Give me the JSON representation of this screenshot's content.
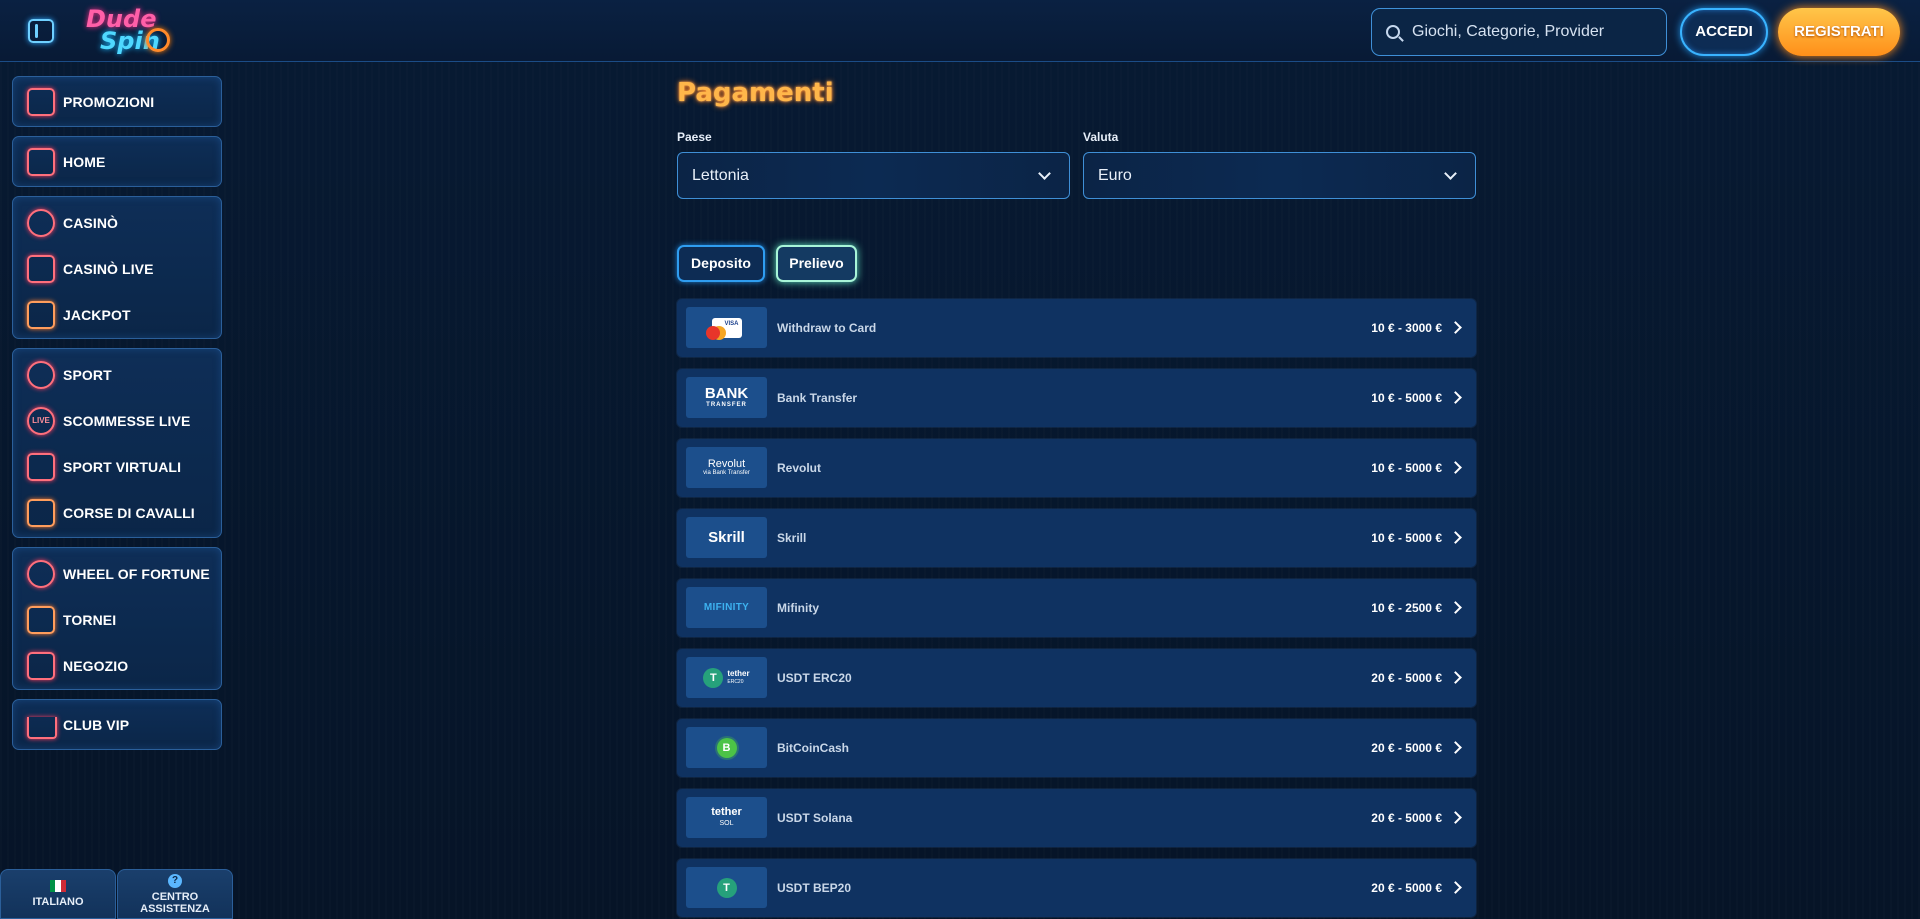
{
  "header": {
    "logo_line1": "Dude",
    "logo_line2": "Spin",
    "search_placeholder": "Giochi, Categorie, Provider",
    "login_label": "ACCEDI",
    "register_label": "REGISTRATI"
  },
  "sidebar": {
    "promotions": "PROMOZIONI",
    "home": "HOME",
    "casino": "CASINÒ",
    "casino_live": "CASINÒ LIVE",
    "jackpot": "JACKPOT",
    "sport": "SPORT",
    "live_bets": "SCOMMESSE LIVE",
    "virtual_sports": "SPORT VIRTUALI",
    "horse_racing": "CORSE DI CAVALLI",
    "wheel_of_fortune": "WHEEL OF FORTUNE",
    "tournaments": "TORNEI",
    "shop": "NEGOZIO",
    "vip_club": "CLUB VIP",
    "live_icon_text": "LIVE"
  },
  "footer": {
    "language": "ITALIANO",
    "help_line1": "CENTRO",
    "help_line2": "ASSISTENZA",
    "help_icon": "?"
  },
  "main": {
    "title": "Pagamenti",
    "country_label": "Paese",
    "country_value": "Lettonia",
    "currency_label": "Valuta",
    "currency_value": "Euro",
    "tab_deposit": "Deposito",
    "tab_withdraw": "Prelievo",
    "active_tab": "Prelievo",
    "methods": [
      {
        "name": "Withdraw to Card",
        "range": "10 € - 3000 €",
        "logo": "VISA"
      },
      {
        "name": "Bank Transfer",
        "range": "10 € - 5000 €",
        "logo": "BANK",
        "logo_sub": "TRANSFER"
      },
      {
        "name": "Revolut",
        "range": "10 € - 5000 €",
        "logo": "Revolut",
        "logo_sub": "via Bank Transfer"
      },
      {
        "name": "Skrill",
        "range": "10 € - 5000 €",
        "logo": "Skrill"
      },
      {
        "name": "Mifinity",
        "range": "10 € - 2500 €",
        "logo": "MIFINITY"
      },
      {
        "name": "USDT ERC20",
        "range": "20 € - 5000 €",
        "logo": "tether",
        "logo_sub": "ERC20",
        "coin": "T"
      },
      {
        "name": "BitCoinCash",
        "range": "20 € - 5000 €",
        "coin": "B"
      },
      {
        "name": "USDT Solana",
        "range": "20 € - 5000 €",
        "logo": "tether",
        "logo_sub": "SOL"
      },
      {
        "name": "USDT BEP20",
        "range": "20 € - 5000 €",
        "coin": "T"
      }
    ]
  },
  "colors": {
    "accent_orange": "#ffb64a",
    "accent_blue": "#39b3ff",
    "icon_neon": "#ff6f7c",
    "row_bg": "#0f3261"
  }
}
